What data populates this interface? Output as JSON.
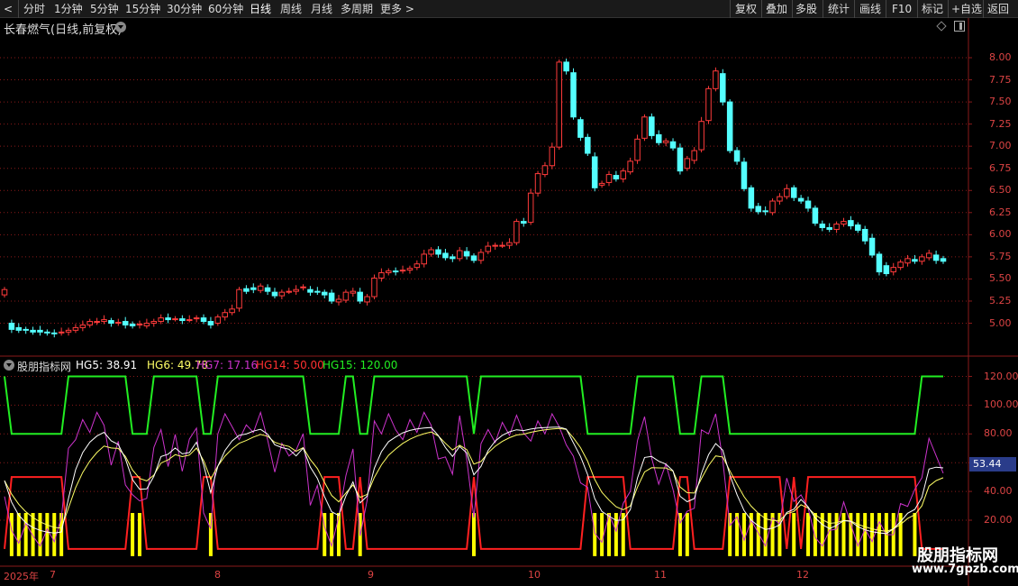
{
  "toolbar": {
    "back_label": "<",
    "periods": [
      "分时",
      "1分钟",
      "5分钟",
      "15分钟",
      "30分钟",
      "60分钟",
      "日线",
      "周线",
      "月线",
      "多周期",
      "更多 >"
    ],
    "active_period": "日线",
    "actions": [
      "复权",
      "叠加",
      "多股",
      "统计",
      "画线",
      "F10",
      "标记",
      "+自选",
      "返回"
    ]
  },
  "stock": {
    "title": "长春燃气(日线,前复权)"
  },
  "indicator": {
    "name": "股朋指标网",
    "hg5": "HG5: 38.91",
    "hg6": "HG6: 49.78",
    "hg7": "HG7: 17.16",
    "hg14": "HG14: 50.00",
    "hg15": "HG15: 120.00",
    "current_value": "53.44"
  },
  "colors": {
    "up": "#ff3b3b",
    "down": "#54ffff",
    "grid": "#8a1a1a",
    "hg5": "#ffffff",
    "hg6": "#ffff66",
    "hg7": "#cc33cc",
    "hg14": "#ff2020",
    "hg15": "#22ee22",
    "bars": "#ffff00"
  },
  "price_axis": [
    "8.00",
    "7.75",
    "7.50",
    "7.25",
    "7.00",
    "6.75",
    "6.50",
    "6.25",
    "6.00",
    "5.75",
    "5.50",
    "5.25",
    "5.00"
  ],
  "indicator_axis": [
    "120.00",
    "100.00",
    "80.00",
    "60.00",
    "40.00",
    "20.00"
  ],
  "dates": [
    "2025年",
    "7",
    "8",
    "9",
    "10",
    "11",
    "12"
  ],
  "watermark": {
    "title": "股朋指标网",
    "url": "www.7gpzb.com"
  },
  "chart_data": {
    "type": "candlestick",
    "ylim": [
      4.8,
      8.15
    ],
    "open": [
      5.32,
      5.0,
      4.95,
      4.93,
      4.92,
      4.92,
      4.9,
      4.89,
      4.89,
      4.9,
      4.92,
      4.95,
      4.98,
      5.02,
      5.02,
      5.03,
      5.0,
      5.02,
      4.99,
      4.98,
      4.97,
      5.0,
      5.02,
      5.06,
      5.05,
      5.05,
      5.04,
      5.05,
      5.06,
      5.02,
      5.0,
      5.07,
      5.12,
      5.17,
      5.39,
      5.4,
      5.37,
      5.4,
      5.35,
      5.31,
      5.36,
      5.36,
      5.4,
      5.38,
      5.36,
      5.35,
      5.34,
      5.24,
      5.26,
      5.34,
      5.35,
      5.24,
      5.3,
      5.51,
      5.57,
      5.59,
      5.59,
      5.6,
      5.63,
      5.67,
      5.78,
      5.83,
      5.79,
      5.75,
      5.73,
      5.81,
      5.76,
      5.71,
      5.81,
      5.87,
      5.88,
      5.88,
      5.91,
      6.15,
      6.14,
      6.47,
      6.68,
      6.78,
      6.99,
      7.95,
      7.83,
      7.3,
      7.1,
      6.88,
      6.56,
      6.59,
      6.67,
      6.63,
      6.71,
      6.84,
      7.09,
      7.33,
      7.13,
      7.04,
      7.05,
      6.98,
      6.75,
      6.84,
      6.96,
      7.29,
      7.65,
      7.82,
      7.5,
      6.95,
      6.82,
      6.53,
      6.32,
      6.27,
      6.25,
      6.38,
      6.43,
      6.53,
      6.41,
      6.38,
      6.3,
      6.12,
      6.08,
      6.06,
      6.12,
      6.16,
      6.11,
      6.06,
      5.96,
      5.78,
      5.65,
      5.58,
      5.63,
      5.68,
      5.72,
      5.7,
      5.74,
      5.77,
      5.73
    ],
    "close": [
      5.38,
      4.93,
      4.92,
      4.92,
      4.9,
      4.9,
      4.89,
      4.88,
      4.9,
      4.92,
      4.95,
      4.98,
      5.02,
      5.02,
      5.04,
      5.0,
      5.01,
      4.98,
      4.97,
      4.99,
      5.0,
      5.02,
      5.06,
      5.04,
      5.05,
      5.03,
      5.04,
      5.06,
      5.02,
      4.98,
      5.07,
      5.12,
      5.16,
      5.38,
      5.36,
      5.38,
      5.42,
      5.36,
      5.31,
      5.35,
      5.36,
      5.38,
      5.41,
      5.35,
      5.35,
      5.32,
      5.25,
      5.27,
      5.35,
      5.36,
      5.25,
      5.3,
      5.51,
      5.57,
      5.59,
      5.58,
      5.6,
      5.62,
      5.67,
      5.78,
      5.83,
      5.78,
      5.74,
      5.73,
      5.82,
      5.76,
      5.71,
      5.8,
      5.87,
      5.88,
      5.88,
      5.91,
      6.15,
      6.13,
      6.47,
      6.69,
      6.78,
      6.99,
      7.95,
      7.85,
      7.33,
      7.1,
      6.92,
      6.53,
      6.58,
      6.68,
      6.63,
      6.72,
      6.83,
      7.08,
      7.33,
      7.12,
      7.04,
      7.06,
      6.98,
      6.72,
      6.86,
      6.95,
      7.28,
      7.65,
      7.85,
      7.5,
      6.95,
      6.83,
      6.52,
      6.3,
      6.26,
      6.26,
      6.38,
      6.43,
      6.52,
      6.42,
      6.38,
      6.3,
      6.13,
      6.08,
      6.06,
      6.12,
      6.15,
      6.1,
      6.05,
      5.93,
      5.77,
      5.58,
      5.56,
      5.63,
      5.69,
      5.73,
      5.7,
      5.75,
      5.79,
      5.71,
      5.7
    ],
    "hg5_indicator": {
      "min": 0,
      "max": 125
    }
  }
}
